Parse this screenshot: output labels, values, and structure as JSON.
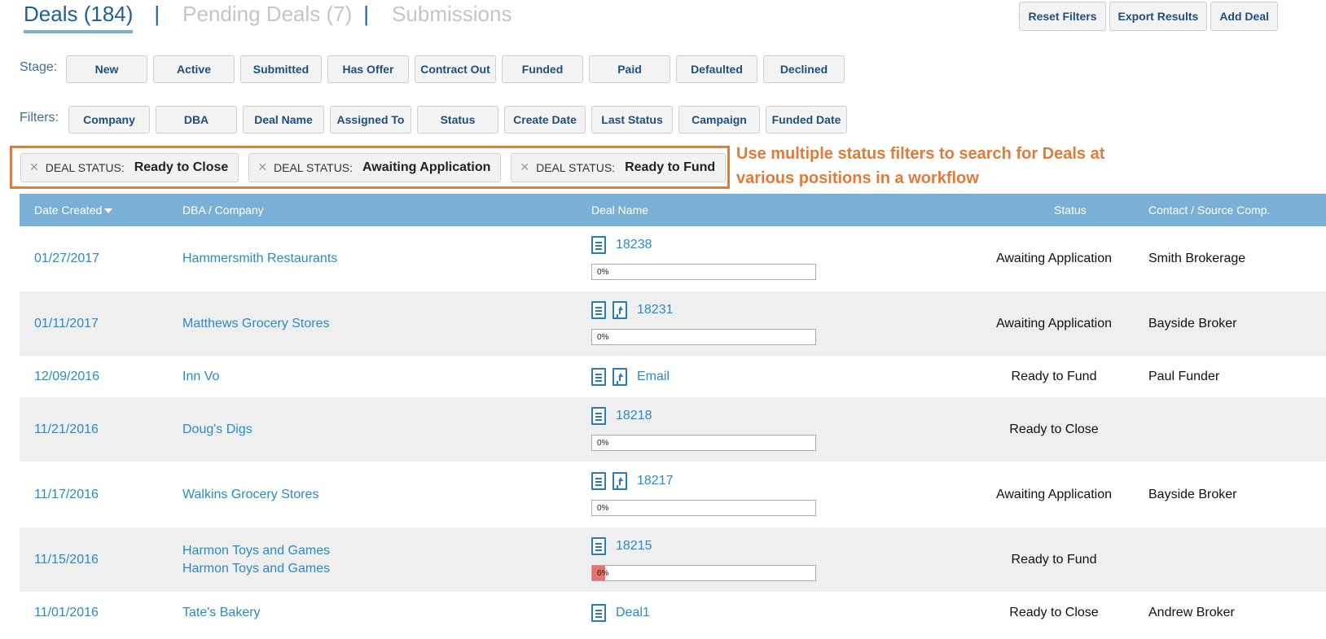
{
  "tabs": {
    "deals": "Deals (184)",
    "pending": "Pending Deals (7)",
    "submissions": "Submissions",
    "sep": "|"
  },
  "actions": {
    "reset": "Reset Filters",
    "export": "Export Results",
    "add": "Add Deal"
  },
  "stage": {
    "label": "Stage:",
    "chips": [
      "New",
      "Active",
      "Submitted",
      "Has Offer",
      "Contract Out",
      "Funded",
      "Paid",
      "Defaulted",
      "Declined"
    ]
  },
  "filters": {
    "label": "Filters:",
    "chips": [
      "Company",
      "DBA",
      "Deal Name",
      "Assigned To",
      "Status",
      "Create Date",
      "Last Status",
      "Campaign",
      "Funded Date"
    ]
  },
  "active_filters": [
    {
      "key": "DEAL STATUS:",
      "value": "Ready to Close"
    },
    {
      "key": "DEAL STATUS:",
      "value": "Awaiting Application"
    },
    {
      "key": "DEAL STATUS:",
      "value": "Ready to Fund"
    }
  ],
  "annotation": "Use multiple status filters to search for Deals at various positions in a workflow",
  "table": {
    "headers": {
      "date": "Date Created",
      "dba": "DBA / Company",
      "deal": "Deal Name",
      "status": "Status",
      "contact": "Contact / Source Comp."
    },
    "rows": [
      {
        "date": "01/27/2017",
        "dba": "Hammersmith Restaurants",
        "dba2": "",
        "deal": "18238",
        "upload": false,
        "progress": "0%",
        "progress_value": 0,
        "status": "Awaiting Application",
        "contact": "Smith Brokerage"
      },
      {
        "date": "01/11/2017",
        "dba": "Matthews Grocery Stores",
        "dba2": "",
        "deal": "18231",
        "upload": true,
        "progress": "0%",
        "progress_value": 0,
        "status": "Awaiting Application",
        "contact": "Bayside Broker"
      },
      {
        "date": "12/09/2016",
        "dba": "Inn Vo",
        "dba2": "",
        "deal": "Email",
        "upload": true,
        "progress": null,
        "status": "Ready to Fund",
        "contact": "Paul Funder"
      },
      {
        "date": "11/21/2016",
        "dba": "Doug's Digs",
        "dba2": "",
        "deal": "18218",
        "upload": false,
        "progress": "0%",
        "progress_value": 0,
        "status": "Ready to Close",
        "contact": ""
      },
      {
        "date": "11/17/2016",
        "dba": "Walkins Grocery Stores",
        "dba2": "",
        "deal": "18217",
        "upload": true,
        "progress": "0%",
        "progress_value": 0,
        "status": "Awaiting Application",
        "contact": "Bayside Broker"
      },
      {
        "date": "11/15/2016",
        "dba": "Harmon Toys and Games",
        "dba2": "Harmon Toys and Games",
        "deal": "18215",
        "upload": false,
        "progress": "6%",
        "progress_value": 6,
        "status": "Ready to Fund",
        "contact": ""
      },
      {
        "date": "11/01/2016",
        "dba": "Tate's Bakery",
        "dba2": "",
        "deal": "Deal1",
        "upload": false,
        "progress": null,
        "status": "Ready to Close",
        "contact": "Andrew Broker"
      }
    ]
  },
  "colors": {
    "accent": "#1f5f95",
    "header_bg": "#7bb0d6",
    "annotation": "#e07b39",
    "link": "#2a8ac8",
    "progress_fill": "#e8706f"
  }
}
